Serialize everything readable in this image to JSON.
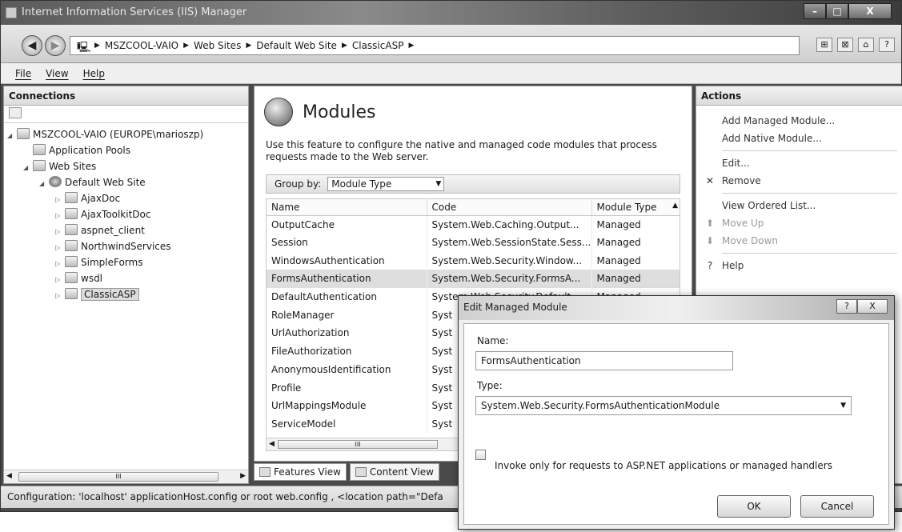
{
  "window": {
    "title": "Internet Information Services (IIS) Manager",
    "min": "–",
    "max": "□",
    "close": "X"
  },
  "breadcrumb": [
    "MSZCOOL-VAIO",
    "Web Sites",
    "Default Web Site",
    "ClassicASP"
  ],
  "menu": [
    "File",
    "View",
    "Help"
  ],
  "connections": {
    "header": "Connections",
    "tree": [
      {
        "label": "MSZCOOL-VAIO (EUROPE\\marioszp)",
        "depth": 0,
        "exp": "◢"
      },
      {
        "label": "Application Pools",
        "depth": 1,
        "exp": ""
      },
      {
        "label": "Web Sites",
        "depth": 1,
        "exp": "◢"
      },
      {
        "label": "Default Web Site",
        "depth": 2,
        "exp": "◢"
      },
      {
        "label": "AjaxDoc",
        "depth": 3,
        "exp": "▷"
      },
      {
        "label": "AjaxToolkitDoc",
        "depth": 3,
        "exp": "▷"
      },
      {
        "label": "aspnet_client",
        "depth": 3,
        "exp": "▷"
      },
      {
        "label": "NorthwindServices",
        "depth": 3,
        "exp": "▷"
      },
      {
        "label": "SimpleForms",
        "depth": 3,
        "exp": "▷"
      },
      {
        "label": "wsdl",
        "depth": 3,
        "exp": "▷"
      },
      {
        "label": "ClassicASP",
        "depth": 3,
        "exp": "▷"
      }
    ]
  },
  "modules": {
    "title": "Modules",
    "description": "Use this feature to configure the native and managed code modules that process requests made to the Web server.",
    "group_label": "Group by:",
    "group_value": "Module Type",
    "columns": [
      "Name",
      "Code",
      "Module Type"
    ],
    "rows": [
      [
        "OutputCache",
        "System.Web.Caching.Output...",
        "Managed"
      ],
      [
        "Session",
        "System.Web.SessionState.Sess...",
        "Managed"
      ],
      [
        "WindowsAuthentication",
        "System.Web.Security.Window...",
        "Managed"
      ],
      [
        "FormsAuthentication",
        "System.Web.Security.FormsA...",
        "Managed"
      ],
      [
        "DefaultAuthentication",
        "System.Web.Security.Default...",
        "Managed"
      ],
      [
        "RoleManager",
        "Syst",
        ""
      ],
      [
        "UrlAuthorization",
        "Syst",
        ""
      ],
      [
        "FileAuthorization",
        "Syst",
        ""
      ],
      [
        "AnonymousIdentification",
        "Syst",
        ""
      ],
      [
        "Profile",
        "Syst",
        ""
      ],
      [
        "UrlMappingsModule",
        "Syst",
        ""
      ],
      [
        "ServiceModel",
        "Syst",
        ""
      ]
    ],
    "selected_row": 3,
    "scroll_thumb": "III"
  },
  "view_tabs": [
    "Features View",
    "Content View"
  ],
  "actions": {
    "header": "Actions",
    "items": [
      {
        "label": "Add Managed Module...",
        "icon": "",
        "enabled": true
      },
      {
        "label": "Add Native Module...",
        "icon": "",
        "enabled": true
      },
      {
        "sep": true
      },
      {
        "label": "Edit...",
        "icon": "",
        "enabled": true
      },
      {
        "label": "Remove",
        "icon": "✕",
        "enabled": true
      },
      {
        "sep": true
      },
      {
        "label": "View Ordered List...",
        "icon": "",
        "enabled": true
      },
      {
        "label": "Move Up",
        "icon": "⬆",
        "enabled": false
      },
      {
        "label": "Move Down",
        "icon": "⬇",
        "enabled": false
      },
      {
        "sep": true
      },
      {
        "label": "Help",
        "icon": "?",
        "enabled": true
      }
    ]
  },
  "status": "Configuration: 'localhost' applicationHost.config or root web.config , <location path=\"Defa",
  "dialog": {
    "title": "Edit Managed Module",
    "help": "?",
    "close": "X",
    "name_label": "Name:",
    "name_value": "FormsAuthentication",
    "type_label": "Type:",
    "type_value": "System.Web.Security.FormsAuthenticationModule",
    "checkbox_label": "Invoke only for requests to ASP.NET applications or managed handlers",
    "checkbox_checked": false,
    "ok": "OK",
    "cancel": "Cancel"
  }
}
